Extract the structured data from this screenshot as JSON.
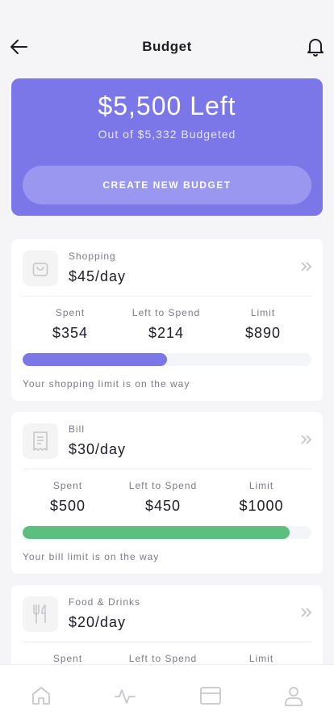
{
  "header": {
    "title": "Budget",
    "back_icon": "arrow-left-icon",
    "bell_icon": "bell-icon"
  },
  "summary": {
    "amount_left": "$5,500 Left",
    "budgeted_text": "Out of $5,332 Budgeted",
    "create_button_label": "CREATE NEW BUDGET",
    "background_color": "#7b77e8"
  },
  "labels": {
    "spent": "Spent",
    "left_to_spend": "Left to Spend",
    "limit": "Limit"
  },
  "budgets": [
    {
      "category": "Shopping",
      "icon": "shopping-bag-icon",
      "per_day": "$45/day",
      "spent": "$354",
      "left_to_spend": "$214",
      "limit": "$890",
      "progress": 0.5,
      "bar_color": "#7b77e8",
      "note": "Your shopping limit is on the way"
    },
    {
      "category": "Bill",
      "icon": "receipt-icon",
      "per_day": "$30/day",
      "spent": "$500",
      "left_to_spend": "$450",
      "limit": "$1000",
      "progress": 0.925,
      "bar_color": "#5cbf7f",
      "note": "Your bill limit is on the way"
    },
    {
      "category": "Food & Drinks",
      "icon": "fork-knife-icon",
      "per_day": "$20/day",
      "spent": "",
      "left_to_spend": "",
      "limit": "",
      "progress": 0,
      "bar_color": "#7b77e8",
      "note": ""
    }
  ],
  "tabbar": {
    "items": [
      "home-icon",
      "activity-icon",
      "wallet-icon",
      "profile-icon"
    ]
  }
}
